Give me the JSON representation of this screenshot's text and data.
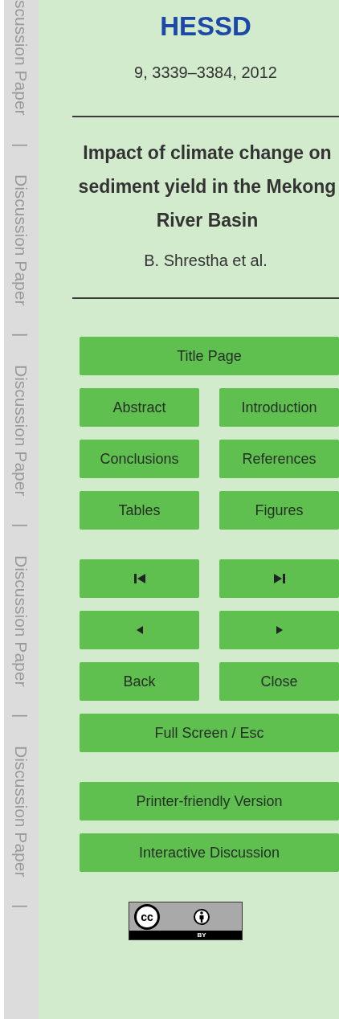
{
  "margin_strip": [
    "scussion Paper",
    "|",
    "Discussion Paper",
    "|",
    "Discussion Paper",
    "|",
    "Discussion Paper",
    "|",
    "Discussion Paper",
    "|"
  ],
  "journal": "HESSD",
  "citation": "9, 3339–3384, 2012",
  "title": "Impact of climate change on sediment yield in the Mekong River Basin",
  "authors": "B. Shrestha et al.",
  "button_groups": [
    [
      [
        {
          "kind": "text",
          "label": "Title Page"
        }
      ],
      [
        {
          "kind": "text",
          "label": "Abstract"
        },
        {
          "kind": "text",
          "label": "Introduction"
        }
      ],
      [
        {
          "kind": "text",
          "label": "Conclusions"
        },
        {
          "kind": "text",
          "label": "References"
        }
      ],
      [
        {
          "kind": "text",
          "label": "Tables"
        },
        {
          "kind": "text",
          "label": "Figures"
        }
      ]
    ],
    [
      [
        {
          "kind": "first"
        },
        {
          "kind": "last"
        }
      ],
      [
        {
          "kind": "previous"
        },
        {
          "kind": "next"
        }
      ],
      [
        {
          "kind": "text",
          "label": "Back"
        },
        {
          "kind": "text",
          "label": "Close"
        }
      ],
      [
        {
          "kind": "text",
          "label": "Full Screen / Esc"
        }
      ]
    ],
    [
      [
        {
          "kind": "text",
          "label": "Printer-friendly Version"
        }
      ],
      [
        {
          "kind": "text",
          "label": "Interactive Discussion"
        }
      ]
    ]
  ],
  "license": {
    "cc": "cc",
    "by": "BY"
  }
}
